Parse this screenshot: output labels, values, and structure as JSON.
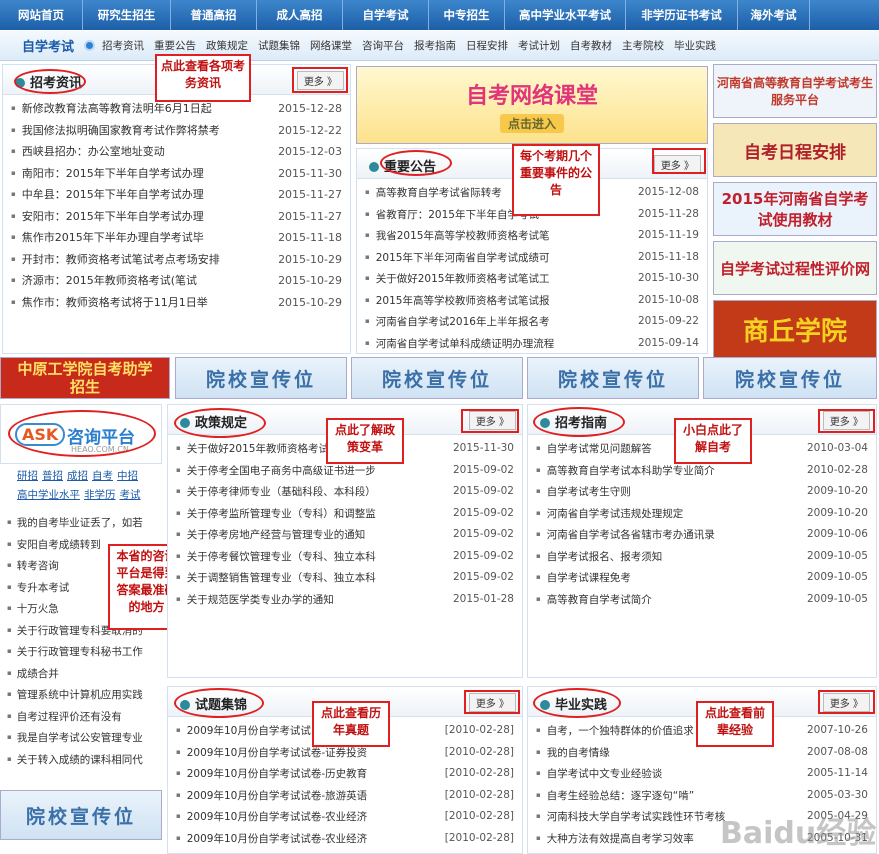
{
  "topnav": [
    "网站首页",
    "研究生招生",
    "普通高招",
    "成人高招",
    "自学考试",
    "中专招生",
    "高中学业水平考试",
    "非学历证书考试",
    "海外考试"
  ],
  "subnav": {
    "brand": "自学考试",
    "items": [
      "招考资讯",
      "重要公告",
      "政策规定",
      "试题集锦",
      "网络课堂",
      "咨询平台",
      "报考指南",
      "日程安排",
      "考试计划",
      "自考教材",
      "主考院校",
      "毕业实践"
    ]
  },
  "more": "更多 》",
  "zhaokao": {
    "title": "招考资讯",
    "note": "点此查看各项考务资讯",
    "rows": [
      [
        "新修改教育法高等教育法明年6月1日起",
        "2015-12-28"
      ],
      [
        "我国修法拟明确国家教育考试作弊将禁考",
        "2015-12-22"
      ],
      [
        "西峡县招办：办公室地址变动",
        "2015-12-03"
      ],
      [
        "南阳市：2015年下半年自学考试办理",
        "2015-11-30"
      ],
      [
        "中牟县：2015年下半年自学考试办理",
        "2015-11-27"
      ],
      [
        "安阳市：2015年下半年自学考试办理",
        "2015-11-27"
      ],
      [
        "焦作市2015年下半年办理自学考试毕",
        "2015-11-18"
      ],
      [
        "开封市：教师资格考试笔试考点考场安排",
        "2015-10-29"
      ],
      [
        "济源市：2015年教师资格考试(笔试",
        "2015-10-29"
      ],
      [
        "焦作市：教师资格考试将于11月1日举",
        "2015-10-29"
      ]
    ]
  },
  "zhongyao": {
    "title": "重要公告",
    "note": "每个考期几个重要事件的公告",
    "rows": [
      [
        "高等教育自学考试省际转考",
        "2015-12-08"
      ],
      [
        "省教育厅：2015年下半年自学考试",
        "2015-11-28"
      ],
      [
        "我省2015年高等学校教师资格考试笔",
        "2015-11-19"
      ],
      [
        "2015年下半年河南省自学考试成绩可",
        "2015-11-18"
      ],
      [
        "关于做好2015年教师资格考试笔试工",
        "2015-10-30"
      ],
      [
        "2015年高等学校教师资格考试笔试报",
        "2015-10-08"
      ],
      [
        "河南省自学考试2016年上半年报名考",
        "2015-09-22"
      ],
      [
        "河南省自学考试单科成绩证明办理流程",
        "2015-09-14"
      ]
    ]
  },
  "ketang": {
    "title": "自考网络课堂",
    "sub": "点击进入"
  },
  "rightads": [
    "河南省高等教育自学考试考生服务平台",
    "自考日程安排",
    "2015年河南省自学考试使用教材",
    "自学考试过程性评价网",
    "商丘学院"
  ],
  "midbanners": [
    "中原工学院自考助学招生",
    "院校宣传位",
    "院校宣传位",
    "院校宣传位",
    "院校宣传位"
  ],
  "ask": {
    "title": "咨询平台",
    "sub": "HEAO.COM.CN",
    "links1": [
      "研招",
      "普招",
      "成招",
      "自考",
      "中招"
    ],
    "links2": [
      "高中学业水平",
      "非学历",
      "考试"
    ],
    "note": "本省的咨询平台是得到答案最准确的地方",
    "rows": [
      "我的自考毕业证丢了，如若",
      "安阳自考成绩转到",
      "转考咨询",
      "专升本考试",
      "十万火急",
      "关于行政管理专科要取消的",
      "关于行政管理专科秘书工作",
      "成绩合并",
      "管理系统中计算机应用实践",
      "自考过程评价还有没有",
      "我是自学考试公安管理专业",
      "关于转入成绩的课科相同代"
    ],
    "ad": "院校宣传位"
  },
  "zhengce": {
    "title": "政策规定",
    "note": "点此了解政策变革",
    "rows": [
      [
        "关于做好2015年教师资格考试",
        "2015-11-30"
      ],
      [
        "关于停考全国电子商务中高级证书进一步",
        "2015-09-02"
      ],
      [
        "关于停考律师专业（基础科段、本科段）",
        "2015-09-02"
      ],
      [
        "关于停考监所管理专业（专科）和调整监",
        "2015-09-02"
      ],
      [
        "关于停考房地产经营与管理专业的通知",
        "2015-09-02"
      ],
      [
        "关于停考餐饮管理专业（专科、独立本科",
        "2015-09-02"
      ],
      [
        "关于调整销售管理专业（专科、独立本科",
        "2015-09-02"
      ],
      [
        "关于规范医学类专业办学的通知",
        "2015-01-28"
      ]
    ]
  },
  "zhinan": {
    "title": "招考指南",
    "note": "小白点此了解自考",
    "rows": [
      [
        "自学考试常见问题解答",
        "2010-03-04"
      ],
      [
        "高等教育自学考试本科助学专业简介",
        "2010-02-28"
      ],
      [
        "自学考试考生守则",
        "2009-10-20"
      ],
      [
        "河南省自学考试违规处理规定",
        "2009-10-20"
      ],
      [
        "河南省自学考试各省辖市考办通讯录",
        "2009-10-06"
      ],
      [
        "自学考试报名、报考须知",
        "2009-10-05"
      ],
      [
        "自学考试课程免考",
        "2009-10-05"
      ],
      [
        "高等教育自学考试简介",
        "2009-10-05"
      ]
    ]
  },
  "shiti": {
    "title": "试题集锦",
    "note": "点此查看历年真题",
    "rows": [
      [
        "2009年10月份自学考试试",
        "[2010-02-28]"
      ],
      [
        "2009年10月份自学考试试卷-证券投资",
        "[2010-02-28]"
      ],
      [
        "2009年10月份自学考试试卷-历史教育",
        "[2010-02-28]"
      ],
      [
        "2009年10月份自学考试试卷-旅游英语",
        "[2010-02-28]"
      ],
      [
        "2009年10月份自学考试试卷-农业经济",
        "[2010-02-28]"
      ],
      [
        "2009年10月份自学考试试卷-农业经济",
        "[2010-02-28]"
      ]
    ]
  },
  "biye": {
    "title": "毕业实践",
    "note": "点此查看前辈经验",
    "rows": [
      [
        "自考，一个独特群体的价值追求",
        "2007-10-26"
      ],
      [
        "我的自考情缘",
        "2007-08-08"
      ],
      [
        "自学考试中文专业经验谈",
        "2005-11-14"
      ],
      [
        "自考生经验总结：逐字逐句“啃”",
        "2005-03-30"
      ],
      [
        "河南科技大学自学考试实践性环节考核",
        "2005-04-29"
      ],
      [
        "大种方法有效提高自考学习效率",
        "2005-10-31"
      ]
    ]
  },
  "watermark": "Baidu经验"
}
